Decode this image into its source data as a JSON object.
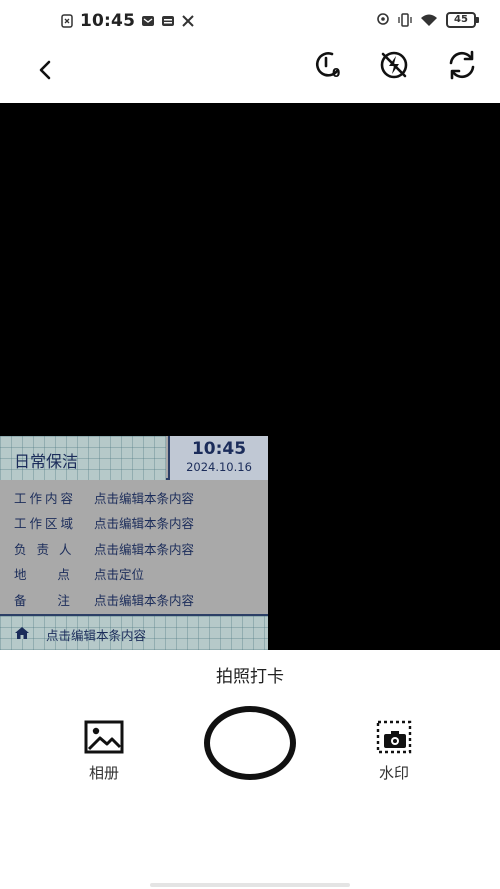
{
  "status_bar": {
    "time": "10:45",
    "battery": "45"
  },
  "toolbar": {
    "timer_value": "0"
  },
  "watermark": {
    "title": "日常保洁",
    "time": "10:45",
    "date": "2024.10.16",
    "rows": [
      {
        "label": "工作内容",
        "value": "点击编辑本条内容"
      },
      {
        "label": "工作区域",
        "value": "点击编辑本条内容"
      },
      {
        "label": "负 责 人",
        "value": "点击编辑本条内容"
      },
      {
        "label": "地    点",
        "value": "点击定位"
      },
      {
        "label": "备    注",
        "value": "点击编辑本条内容"
      }
    ],
    "footer": "点击编辑本条内容"
  },
  "bottom": {
    "caption": "拍照打卡",
    "album_label": "相册",
    "watermark_label": "水印"
  }
}
